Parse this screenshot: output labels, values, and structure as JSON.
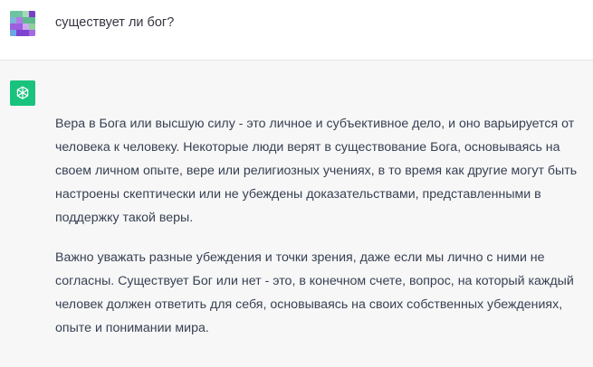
{
  "user_message": {
    "avatar_icon": "user-avatar-icon",
    "text": "существует ли бог?"
  },
  "assistant_message": {
    "avatar_icon": "openai-logo-icon",
    "avatar_color": "#19c37d",
    "paragraphs": [
      "Вера в Бога или высшую силу - это личное и субъективное дело, и оно варьируется от человека к человеку. Некоторые люди верят в существование Бога, основываясь на своем личном опыте, вере или религиозных учениях, в то время как другие могут быть настроены скептически или не убеждены доказательствами, представленными в поддержку такой веры.",
      "Важно уважать разные убеждения и точки зрения, даже если мы лично с ними не согласны. Существует Бог или нет - это, в конечном счете, вопрос, на который каждый человек должен ответить для себя, основываясь на своих собственных убеждениях, опыте и понимании мира."
    ]
  }
}
